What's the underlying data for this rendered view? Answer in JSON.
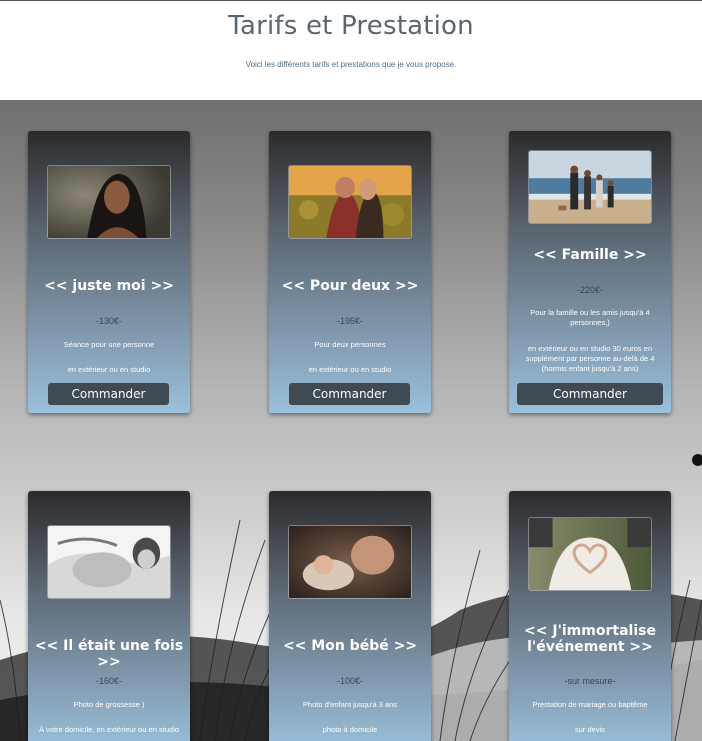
{
  "header": {
    "title": "Tarifs et Prestation",
    "subtitle": "Voici les différents tarifs et prestations que je vous propose."
  },
  "cards": [
    {
      "title": "<< juste moi >>",
      "price": "-130€-",
      "desc1": "Séance pour une personne",
      "desc2": "en extérieur ou en studio",
      "button": "Commander",
      "photo_icon": "portrait-photo"
    },
    {
      "title": "<< Pour deux >>",
      "price": "-195€-",
      "desc1": "Pour deux personnes",
      "desc2": "en extérieur ou en studio",
      "button": "Commander",
      "photo_icon": "couple-photo"
    },
    {
      "title": "<< Famille >>",
      "price": "-220€-",
      "desc1": "Pour la famille ou les amis jusqu'à 4 personnes,)",
      "desc2": "en extérieur ou en studio 30 euros en supplément par personne au-delà de 4 (hormis enfant jusqu'à 2 ans)",
      "button": "Commander",
      "photo_icon": "family-beach-photo"
    },
    {
      "title": "<< Il était une fois >>",
      "price": "-160€-",
      "desc1": "Photo de grossesse )",
      "desc2": "À votre domicile, en extérieur ou en studio",
      "photo_icon": "pregnancy-photo"
    },
    {
      "title": "<< Mon bébé >>",
      "price": "-100€-",
      "desc1": "Photo d'enfant jusqu'à 3 ans",
      "desc2": "photo à domicile",
      "photo_icon": "baby-photo"
    },
    {
      "title": "<< J'immortalise l'événement >>",
      "price": "-sur mesure-",
      "desc1": "Prestation de mariage ou baptême",
      "desc2": "sur devis",
      "photo_icon": "wedding-heart-photo"
    }
  ]
}
